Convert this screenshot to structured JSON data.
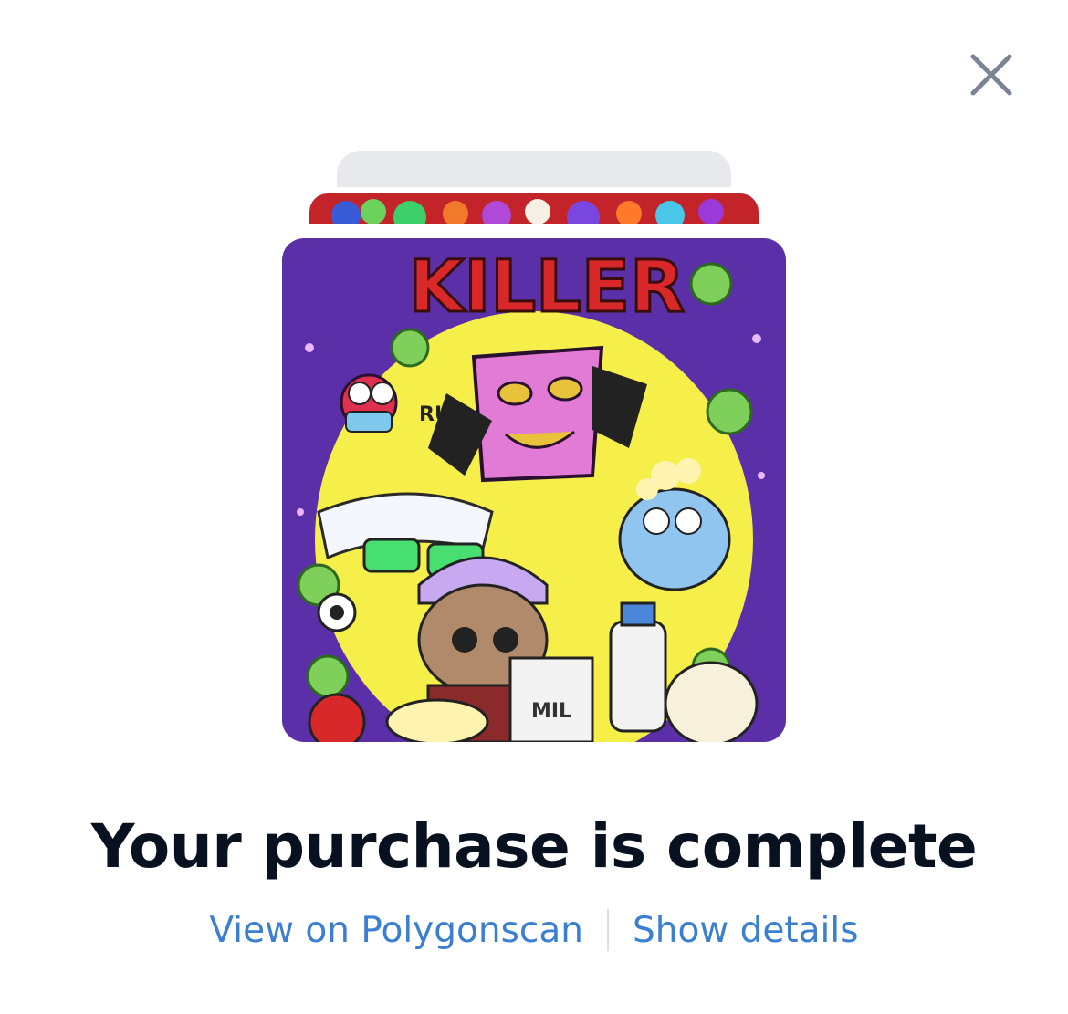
{
  "modal": {
    "close_icon": "close-icon",
    "nft_art_text": "KILLER",
    "nft_art_small_text_1": "RUN",
    "nft_art_small_text_2": "MIL",
    "title": "Your purchase is complete",
    "link_polygonscan": "View on Polygonscan",
    "link_details": "Show details"
  },
  "colors": {
    "title": "#08111f",
    "link": "#3b7fd0",
    "close": "#7a8494",
    "stack_back": "#e8e9ec",
    "art_purple": "#5a2fa8",
    "art_yellow": "#f6ef4a",
    "art_red": "#d8282a"
  }
}
